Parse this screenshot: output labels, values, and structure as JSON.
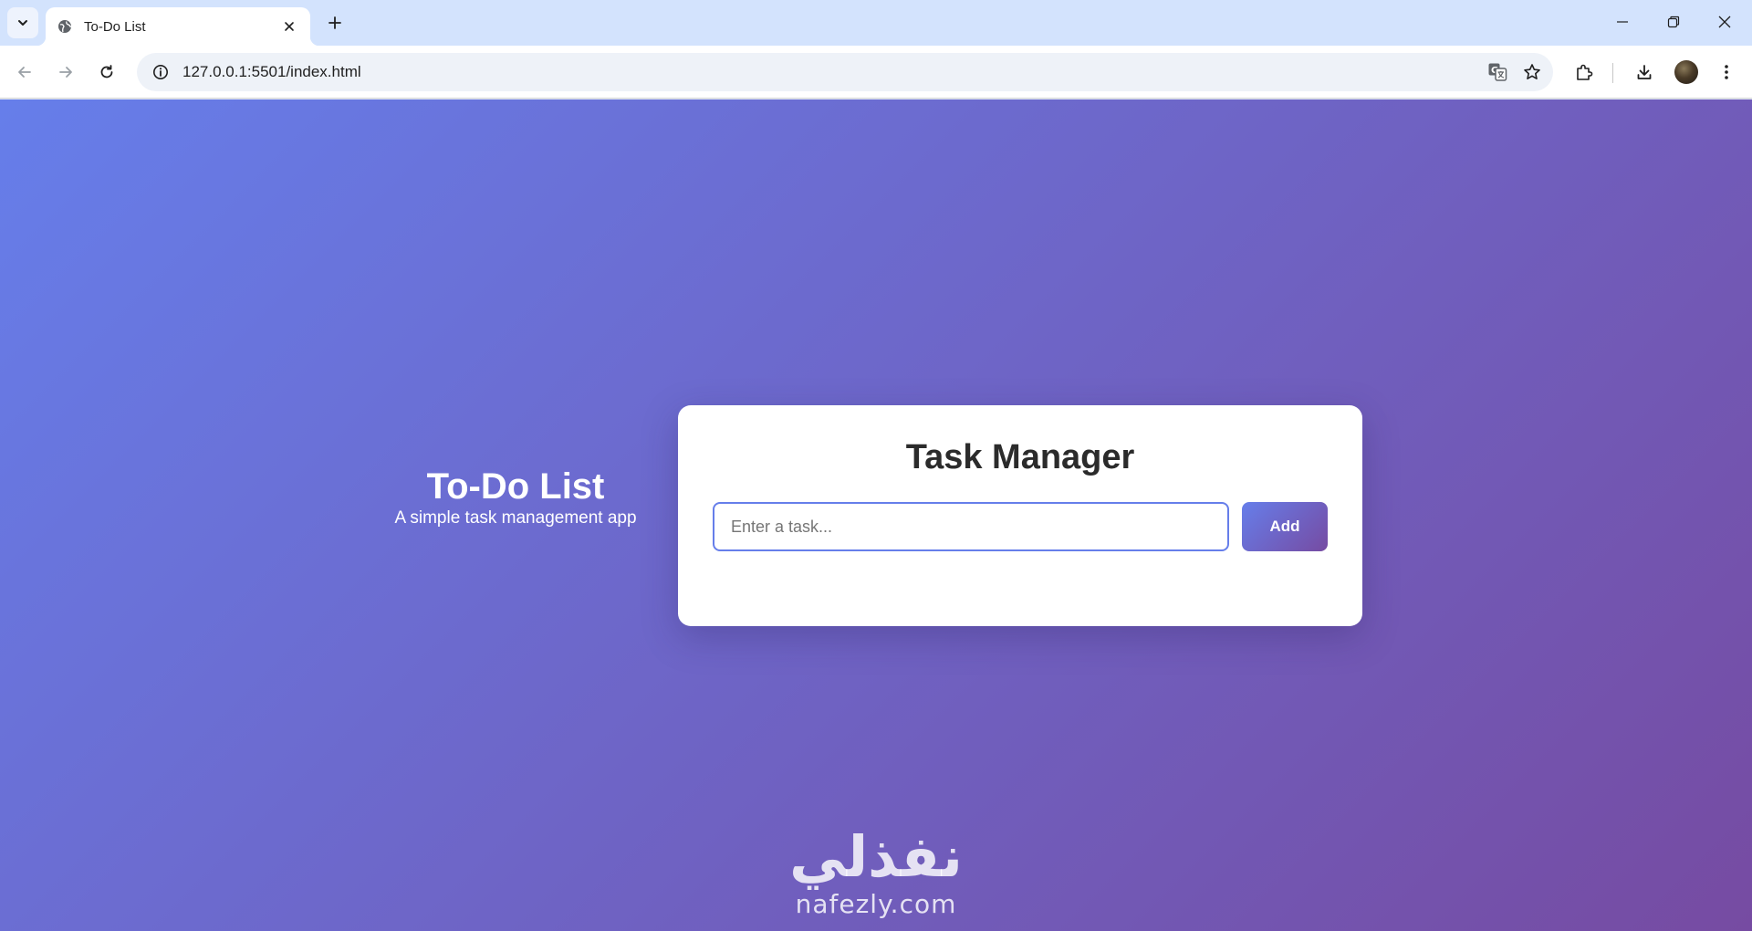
{
  "browser": {
    "tab": {
      "title": "To-Do List",
      "favicon": "globe-icon"
    },
    "address_bar": {
      "url": "127.0.0.1:5501/index.html"
    },
    "icons": {
      "tab_search": "chevron-down-icon",
      "new_tab": "plus-icon",
      "back": "arrow-left-icon",
      "forward": "arrow-right-icon",
      "reload": "reload-icon",
      "site_info": "info-icon",
      "translate": "translate-icon",
      "bookmark": "star-icon",
      "extensions": "puzzle-icon",
      "downloads": "download-icon",
      "menu": "kebab-menu-icon",
      "minimize": "minimize-icon",
      "restore": "restore-icon",
      "close": "close-icon"
    }
  },
  "page": {
    "hero": {
      "title": "To-Do List",
      "subtitle": "A simple task management app"
    },
    "card": {
      "title": "Task Manager",
      "input": {
        "placeholder": "Enter a task...",
        "value": ""
      },
      "add_button_label": "Add"
    },
    "watermark": {
      "arabic_text": "نفذلي",
      "latin_text": "nafezly.com"
    },
    "colors": {
      "gradient_start": "#667eea",
      "gradient_end": "#764ba2",
      "card_bg": "#ffffff",
      "title_text": "#2b2b2b"
    }
  }
}
